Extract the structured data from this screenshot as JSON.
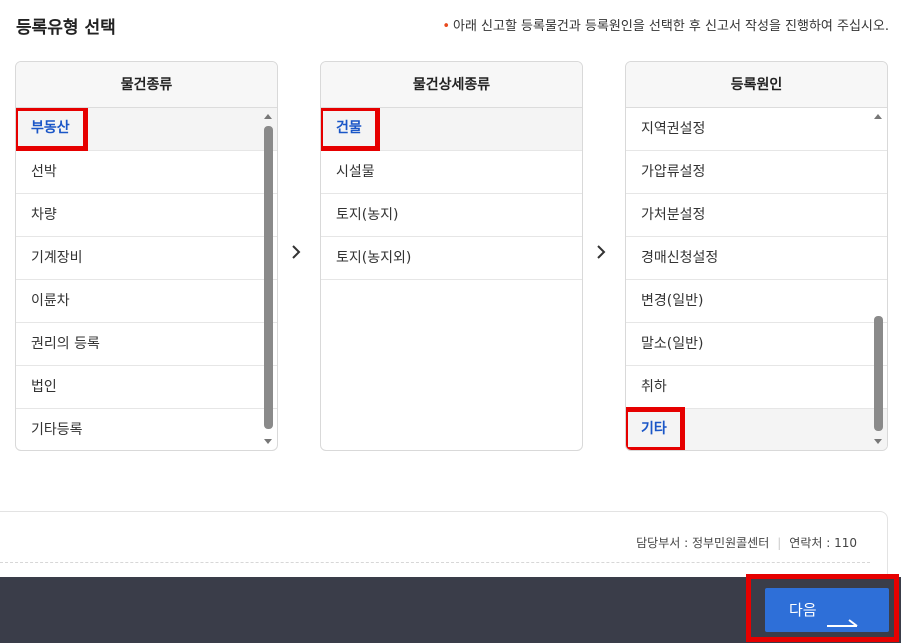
{
  "header": {
    "title": "등록유형 선택",
    "notice_bullet": "•",
    "notice": "아래 신고할 등록물건과 등록원인을 선택한 후 신고서 작성을 진행하여 주십시오."
  },
  "panels": [
    {
      "header": "물건종류",
      "items": [
        "부동산",
        "선박",
        "차량",
        "기계장비",
        "이륜차",
        "권리의 등록",
        "법인",
        "기타등록"
      ],
      "selected_index": 0
    },
    {
      "header": "물건상세종류",
      "items": [
        "건물",
        "시설물",
        "토지(농지)",
        "토지(농지외)"
      ],
      "selected_index": 0
    },
    {
      "header": "등록원인",
      "items": [
        "지역권설정",
        "가압류설정",
        "가처분설정",
        "경매신청설정",
        "변경(일반)",
        "말소(일반)",
        "취하",
        "기타"
      ],
      "selected_index": 7
    }
  ],
  "contact": {
    "department": "담당부서 : 정부민원콜센터",
    "separator": "|",
    "phone": "연락처 : 110"
  },
  "footer": {
    "next_label": "다음"
  },
  "colors": {
    "selected_text": "#1a56c7",
    "highlight_border": "#e60000",
    "footer_bg": "#3a3d49",
    "next_button": "#2e6fd8",
    "notice_dot": "#e8491d"
  },
  "icons": {
    "step_arrow": "chevron-right-icon",
    "next_arrow": "long-arrow-right-icon"
  }
}
